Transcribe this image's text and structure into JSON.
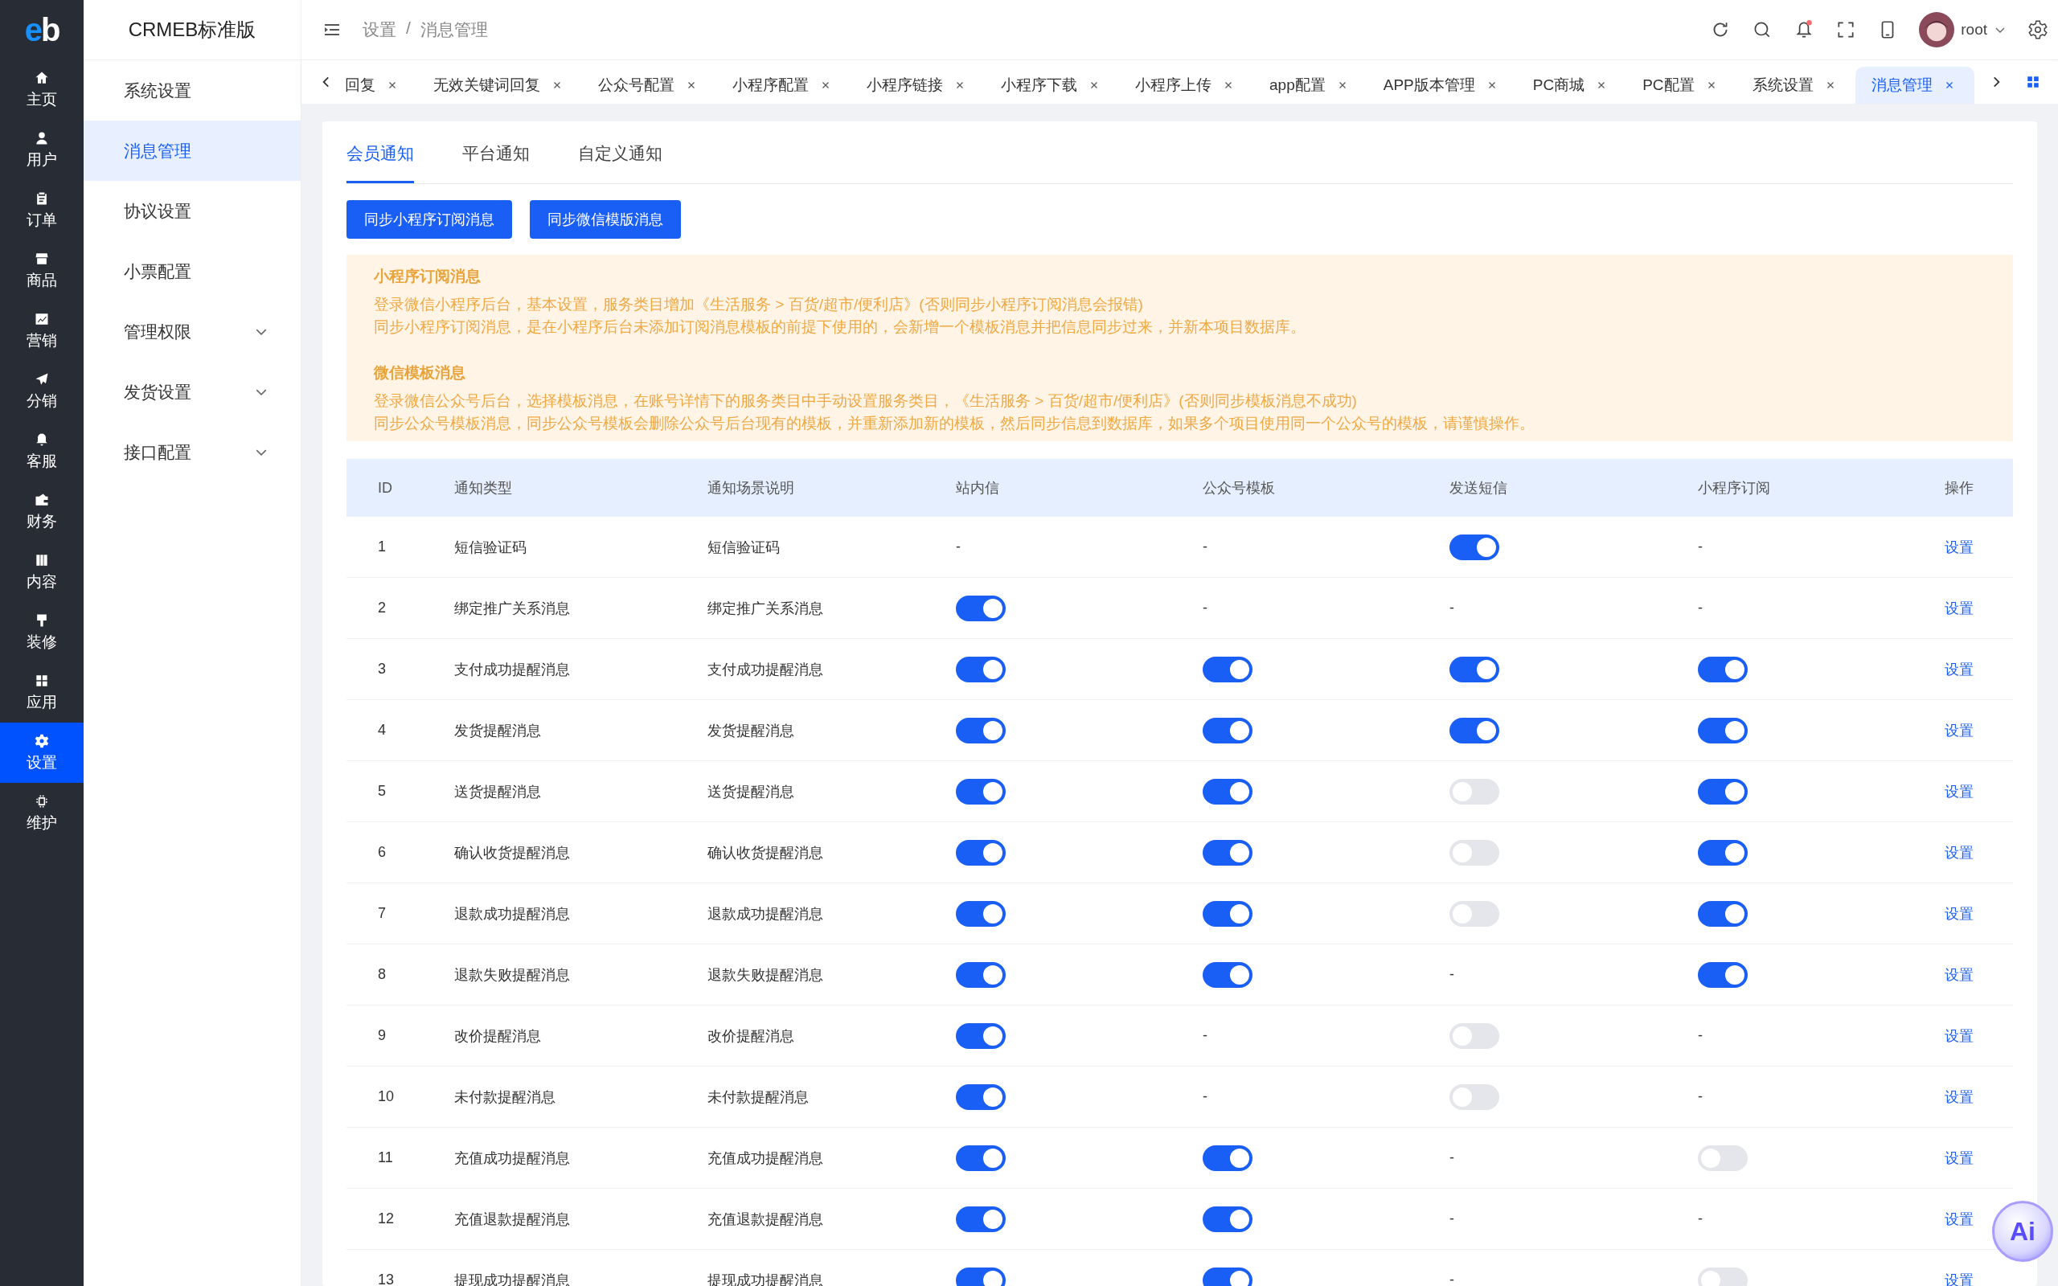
{
  "brand": {
    "logo": "eb",
    "title": "CRMEB标准版"
  },
  "rail": [
    {
      "label": "主页",
      "selected": false
    },
    {
      "label": "用户",
      "selected": false
    },
    {
      "label": "订单",
      "selected": false
    },
    {
      "label": "商品",
      "selected": false
    },
    {
      "label": "营销",
      "selected": false
    },
    {
      "label": "分销",
      "selected": false
    },
    {
      "label": "客服",
      "selected": false
    },
    {
      "label": "财务",
      "selected": false
    },
    {
      "label": "内容",
      "selected": false
    },
    {
      "label": "装修",
      "selected": false
    },
    {
      "label": "应用",
      "selected": false
    },
    {
      "label": "设置",
      "selected": true
    },
    {
      "label": "维护",
      "selected": false
    }
  ],
  "submenu": [
    {
      "label": "系统设置",
      "selected": false,
      "expandable": false
    },
    {
      "label": "消息管理",
      "selected": true,
      "expandable": false
    },
    {
      "label": "协议设置",
      "selected": false,
      "expandable": false
    },
    {
      "label": "小票配置",
      "selected": false,
      "expandable": false
    },
    {
      "label": "管理权限",
      "selected": false,
      "expandable": true
    },
    {
      "label": "发货设置",
      "selected": false,
      "expandable": true
    },
    {
      "label": "接口配置",
      "selected": false,
      "expandable": true
    }
  ],
  "breadcrumb": {
    "items": [
      "设置",
      "消息管理"
    ],
    "separator": "/"
  },
  "header": {
    "user": "root",
    "notification_dot": true
  },
  "page_tabs": [
    {
      "label": "回复",
      "selected": false
    },
    {
      "label": "无效关键词回复",
      "selected": false
    },
    {
      "label": "公众号配置",
      "selected": false
    },
    {
      "label": "小程序配置",
      "selected": false
    },
    {
      "label": "小程序链接",
      "selected": false
    },
    {
      "label": "小程序下载",
      "selected": false
    },
    {
      "label": "小程序上传",
      "selected": false
    },
    {
      "label": "app配置",
      "selected": false
    },
    {
      "label": "APP版本管理",
      "selected": false
    },
    {
      "label": "PC商城",
      "selected": false
    },
    {
      "label": "PC配置",
      "selected": false
    },
    {
      "label": "系统设置",
      "selected": false
    },
    {
      "label": "消息管理",
      "selected": true
    }
  ],
  "notice_tabs": [
    {
      "label": "会员通知",
      "selected": true
    },
    {
      "label": "平台通知",
      "selected": false
    },
    {
      "label": "自定义通知",
      "selected": false
    }
  ],
  "buttons": [
    "同步小程序订阅消息",
    "同步微信模版消息"
  ],
  "notice": [
    {
      "title": "小程序订阅消息",
      "lines": [
        "登录微信小程序后台，基本设置，服务类目增加《生活服务 > 百货/超市/便利店》(否则同步小程序订阅消息会报错)",
        "同步小程序订阅消息，是在小程序后台未添加订阅消息模板的前提下使用的，会新增一个模板消息并把信息同步过来，并新本项目数据库。"
      ]
    },
    {
      "title": "微信模板消息",
      "lines": [
        "登录微信公众号后台，选择模板消息，在账号详情下的服务类目中手动设置服务类目，《生活服务 > 百货/超市/便利店》(否则同步模板消息不成功)",
        "同步公众号模板消息，同步公众号模板会删除公众号后台现有的模板，并重新添加新的模板，然后同步信息到数据库，如果多个项目使用同一个公众号的模板，请谨慎操作。"
      ]
    }
  ],
  "table": {
    "columns": [
      "ID",
      "通知类型",
      "通知场景说明",
      "站内信",
      "公众号模板",
      "发送短信",
      "小程序订阅",
      "操作"
    ],
    "rows": [
      {
        "cells": [
          {
            "kind": "text",
            "text": "1"
          },
          {
            "kind": "text",
            "text": "短信验证码"
          },
          {
            "kind": "text",
            "text": "短信验证码"
          },
          {
            "kind": "text",
            "text": "-"
          },
          {
            "kind": "text",
            "text": "-"
          },
          {
            "kind": "switch",
            "on": true
          },
          {
            "kind": "text",
            "text": "-"
          },
          {
            "kind": "link",
            "text": "设置"
          }
        ]
      },
      {
        "cells": [
          {
            "kind": "text",
            "text": "2"
          },
          {
            "kind": "text",
            "text": "绑定推广关系消息"
          },
          {
            "kind": "text",
            "text": "绑定推广关系消息"
          },
          {
            "kind": "switch",
            "on": true
          },
          {
            "kind": "text",
            "text": "-"
          },
          {
            "kind": "text",
            "text": "-"
          },
          {
            "kind": "text",
            "text": "-"
          },
          {
            "kind": "link",
            "text": "设置"
          }
        ]
      },
      {
        "cells": [
          {
            "kind": "text",
            "text": "3"
          },
          {
            "kind": "text",
            "text": "支付成功提醒消息"
          },
          {
            "kind": "text",
            "text": "支付成功提醒消息"
          },
          {
            "kind": "switch",
            "on": true
          },
          {
            "kind": "switch",
            "on": true
          },
          {
            "kind": "switch",
            "on": true
          },
          {
            "kind": "switch",
            "on": true
          },
          {
            "kind": "link",
            "text": "设置"
          }
        ]
      },
      {
        "cells": [
          {
            "kind": "text",
            "text": "4"
          },
          {
            "kind": "text",
            "text": "发货提醒消息"
          },
          {
            "kind": "text",
            "text": "发货提醒消息"
          },
          {
            "kind": "switch",
            "on": true
          },
          {
            "kind": "switch",
            "on": true
          },
          {
            "kind": "switch",
            "on": true
          },
          {
            "kind": "switch",
            "on": true
          },
          {
            "kind": "link",
            "text": "设置"
          }
        ]
      },
      {
        "cells": [
          {
            "kind": "text",
            "text": "5"
          },
          {
            "kind": "text",
            "text": "送货提醒消息"
          },
          {
            "kind": "text",
            "text": "送货提醒消息"
          },
          {
            "kind": "switch",
            "on": true
          },
          {
            "kind": "switch",
            "on": true
          },
          {
            "kind": "switch",
            "on": false
          },
          {
            "kind": "switch",
            "on": true
          },
          {
            "kind": "link",
            "text": "设置"
          }
        ]
      },
      {
        "cells": [
          {
            "kind": "text",
            "text": "6"
          },
          {
            "kind": "text",
            "text": "确认收货提醒消息"
          },
          {
            "kind": "text",
            "text": "确认收货提醒消息"
          },
          {
            "kind": "switch",
            "on": true
          },
          {
            "kind": "switch",
            "on": true
          },
          {
            "kind": "switch",
            "on": false
          },
          {
            "kind": "switch",
            "on": true
          },
          {
            "kind": "link",
            "text": "设置"
          }
        ]
      },
      {
        "cells": [
          {
            "kind": "text",
            "text": "7"
          },
          {
            "kind": "text",
            "text": "退款成功提醒消息"
          },
          {
            "kind": "text",
            "text": "退款成功提醒消息"
          },
          {
            "kind": "switch",
            "on": true
          },
          {
            "kind": "switch",
            "on": true
          },
          {
            "kind": "switch",
            "on": false
          },
          {
            "kind": "switch",
            "on": true
          },
          {
            "kind": "link",
            "text": "设置"
          }
        ]
      },
      {
        "cells": [
          {
            "kind": "text",
            "text": "8"
          },
          {
            "kind": "text",
            "text": "退款失败提醒消息"
          },
          {
            "kind": "text",
            "text": "退款失败提醒消息"
          },
          {
            "kind": "switch",
            "on": true
          },
          {
            "kind": "switch",
            "on": true
          },
          {
            "kind": "text",
            "text": "-"
          },
          {
            "kind": "switch",
            "on": true
          },
          {
            "kind": "link",
            "text": "设置"
          }
        ]
      },
      {
        "cells": [
          {
            "kind": "text",
            "text": "9"
          },
          {
            "kind": "text",
            "text": "改价提醒消息"
          },
          {
            "kind": "text",
            "text": "改价提醒消息"
          },
          {
            "kind": "switch",
            "on": true
          },
          {
            "kind": "text",
            "text": "-"
          },
          {
            "kind": "switch",
            "on": false
          },
          {
            "kind": "text",
            "text": "-"
          },
          {
            "kind": "link",
            "text": "设置"
          }
        ]
      },
      {
        "cells": [
          {
            "kind": "text",
            "text": "10"
          },
          {
            "kind": "text",
            "text": "未付款提醒消息"
          },
          {
            "kind": "text",
            "text": "未付款提醒消息"
          },
          {
            "kind": "switch",
            "on": true
          },
          {
            "kind": "text",
            "text": "-"
          },
          {
            "kind": "switch",
            "on": false
          },
          {
            "kind": "text",
            "text": "-"
          },
          {
            "kind": "link",
            "text": "设置"
          }
        ]
      },
      {
        "cells": [
          {
            "kind": "text",
            "text": "11"
          },
          {
            "kind": "text",
            "text": "充值成功提醒消息"
          },
          {
            "kind": "text",
            "text": "充值成功提醒消息"
          },
          {
            "kind": "switch",
            "on": true
          },
          {
            "kind": "switch",
            "on": true
          },
          {
            "kind": "text",
            "text": "-"
          },
          {
            "kind": "switch",
            "on": false
          },
          {
            "kind": "link",
            "text": "设置"
          }
        ]
      },
      {
        "cells": [
          {
            "kind": "text",
            "text": "12"
          },
          {
            "kind": "text",
            "text": "充值退款提醒消息"
          },
          {
            "kind": "text",
            "text": "充值退款提醒消息"
          },
          {
            "kind": "switch",
            "on": true
          },
          {
            "kind": "switch",
            "on": true
          },
          {
            "kind": "text",
            "text": "-"
          },
          {
            "kind": "text",
            "text": "-"
          },
          {
            "kind": "link",
            "text": "设置"
          }
        ]
      },
      {
        "cells": [
          {
            "kind": "text",
            "text": "13"
          },
          {
            "kind": "text",
            "text": "提现成功提醒消息"
          },
          {
            "kind": "text",
            "text": "提现成功提醒消息"
          },
          {
            "kind": "switch",
            "on": true
          },
          {
            "kind": "switch",
            "on": true
          },
          {
            "kind": "text",
            "text": "-"
          },
          {
            "kind": "switch",
            "on": false
          },
          {
            "kind": "link",
            "text": "设置"
          }
        ]
      }
    ]
  },
  "assistant": {
    "label": "Ai"
  }
}
